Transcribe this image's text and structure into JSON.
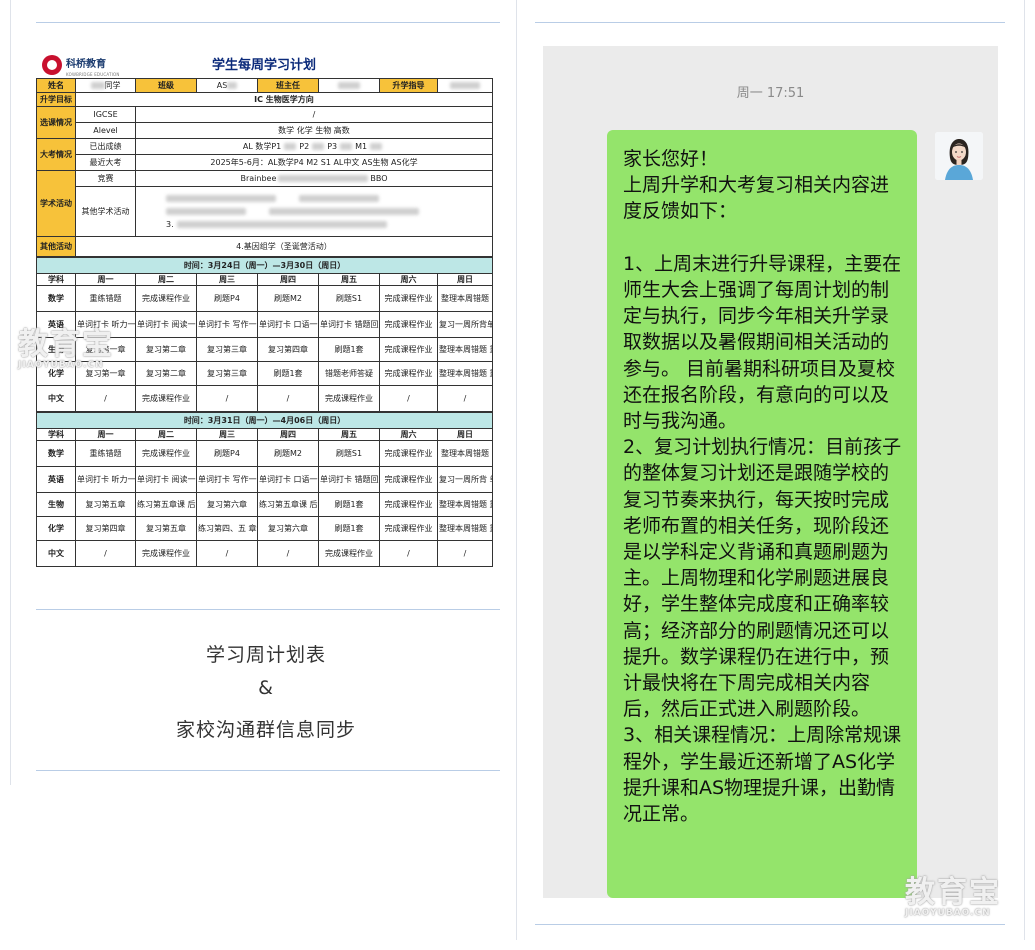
{
  "sheet": {
    "brand": "科桥教育",
    "brand_sub": "KOWBRIDGE EDUCATION",
    "title": "学生每周学习计划",
    "info": {
      "name_label": "姓名",
      "name_value": "同学",
      "class_label": "班级",
      "class_value": "AS",
      "teacher_label": "班主任",
      "advisor_label": "升学指导"
    },
    "goal_label": "升学目标",
    "goal_value": "IC 生物医学方向",
    "course_label": "选课情况",
    "igcse": "IGCSE",
    "igcse_value": "/",
    "alevel": "Alevel",
    "alevel_value": "数学 化学 生物 高数",
    "exam_label": "大考情况",
    "exam_done": "已出成绩",
    "exam_done_v": [
      "AL 数学P1",
      "P2",
      "P3",
      "M1"
    ],
    "exam_recent": "最近大考",
    "exam_recent_value": "2025年5-6月：AL数学P4 M2 S1 AL中文   AS生物   AS化学",
    "academic_label": "学术活动",
    "competition": "竞赛",
    "competition_value": [
      "Brainbee",
      "BBO"
    ],
    "other_academic": "其他学术活动",
    "other_academic_item": "3.",
    "other_label": "其他活动",
    "other_value": "4.基因组学（圣诞营活动）",
    "weeks": [
      {
        "title": "时间：3月24日（周一）—3月30日（周日）",
        "header": [
          "学科",
          "周一",
          "周二",
          "周三",
          "周四",
          "周五",
          "周六",
          "周日"
        ],
        "rows": [
          [
            "数学",
            "重练错题",
            "完成课程作业",
            "刷题P4",
            "刷题M2",
            "刷题S1",
            "完成课程作业",
            "整理本周错题"
          ],
          [
            "英语",
            "单词打卡 听力一套",
            "单词打卡 阅读一套",
            "单词打卡 写作一套",
            "单词打卡 口语一套",
            "单词打卡 错题回顾",
            "完成课程作业",
            "复习一周所背单词"
          ],
          [
            "生物",
            "复习第一章",
            "复习第二章",
            "复习第三章",
            "复习第四章",
            "刷题1套",
            "完成课程作业",
            "整理本周错题 重练"
          ],
          [
            "化学",
            "复习第一章",
            "复习第二章",
            "复习第三章",
            "刷题1套",
            "错题老师答疑",
            "完成课程作业",
            "整理本周错题 重练"
          ],
          [
            "中文",
            "/",
            "完成课程作业",
            "/",
            "/",
            "完成课程作业",
            "/",
            "/"
          ]
        ]
      },
      {
        "title": "时间：3月31日（周一）—4月06日（周日）",
        "header": [
          "学科",
          "周一",
          "周二",
          "周三",
          "周四",
          "周五",
          "周六",
          "周日"
        ],
        "rows": [
          [
            "数学",
            "重练错题",
            "完成课程作业",
            "刷题P4",
            "刷题M2",
            "刷题S1",
            "完成课程作业",
            "整理本周错题"
          ],
          [
            "英语",
            "单词打卡 听力一套",
            "单词打卡 阅读一套",
            "单词打卡 写作一套",
            "单词打卡 口语一套",
            "单词打卡 错题回顾",
            "完成课程作业",
            "复习一周所背 单词"
          ],
          [
            "生物",
            "复习第五章",
            "练习第五章课 后习题",
            "复习第六章",
            "练习第五章课 后习题",
            "刷题1套",
            "完成课程作业",
            "整理本周错题 重练"
          ],
          [
            "化学",
            "复习第四章",
            "复习第五章",
            "练习第四、五 章课后习题",
            "复习第六章",
            "刷题1套",
            "完成课程作业",
            "整理本周错题 重练"
          ],
          [
            "中文",
            "/",
            "完成课程作业",
            "/",
            "/",
            "完成课程作业",
            "/",
            "/"
          ]
        ]
      }
    ]
  },
  "caption": {
    "line1": "学习周计划表",
    "line2": "&",
    "line3": "家校沟通群信息同步"
  },
  "chat": {
    "time": "周一 17:51",
    "message": "家长您好！\n上周升学和大考复习相关内容进度反馈如下：\n\n1、上周末进行升导课程，主要在师生大会上强调了每周计划的制定与执行，同步今年相关升学录取数据以及暑假期间相关活动的参与。 目前暑期科研项目及夏校还在报名阶段，有意向的可以及时与我沟通。\n2、复习计划执行情况：目前孩子的整体复习计划还是跟随学校的复习节奏来执行，每天按时完成老师布置的相关任务，现阶段还是以学科定义背诵和真题刷题为主。上周物理和化学刷题进展良好，学生整体完成度和正确率较高；经济部分的刷题情况还可以提升。数学课程仍在进行中，预计最快将在下周完成相关内容后，然后正式进入刷题阶段。\n3、相关课程情况：上周除常规课程外，学生最近还新增了AS化学提升课和AS物理提升课，出勤情况正常。"
  },
  "watermark": {
    "text": "教育宝",
    "sub": "JIAOYUBAO.CN"
  }
}
